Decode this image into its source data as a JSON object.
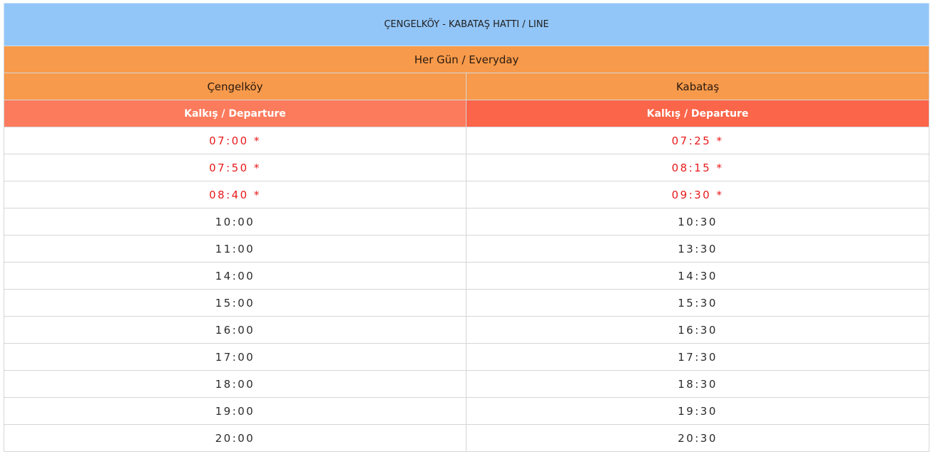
{
  "title": "ÇENGELKÖY - KABATAŞ HATTI / LINE",
  "schedule": "Her Gün / Everyday",
  "stations": [
    "Çengelköy",
    "Kabataş"
  ],
  "departure_label": "Kalkış / Departure",
  "colors": {
    "title_bg": "#93c6f8",
    "schedule_bg": "#f79a4b",
    "departure_left_bg": "#fc7b5d",
    "departure_right_bg": "#fb6549",
    "marked_time": "#e8191b"
  },
  "rows": [
    [
      "07:00 *",
      "07:25 *"
    ],
    [
      "07:50 *",
      "08:15 *"
    ],
    [
      "08:40 *",
      "09:30 *"
    ],
    [
      "10:00",
      "10:30"
    ],
    [
      "11:00",
      "13:30"
    ],
    [
      "14:00",
      "14:30"
    ],
    [
      "15:00",
      "15:30"
    ],
    [
      "16:00",
      "16:30"
    ],
    [
      "17:00",
      "17:30"
    ],
    [
      "18:00",
      "18:30"
    ],
    [
      "19:00",
      "19:30"
    ],
    [
      "20:00",
      "20:30"
    ]
  ]
}
